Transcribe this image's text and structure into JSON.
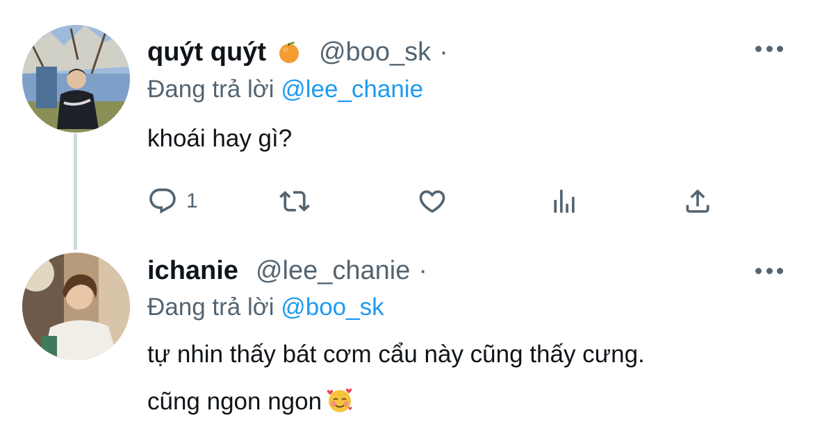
{
  "tweets": [
    {
      "display_name": "quýt quýt",
      "name_emoji": "orange-emoji",
      "handle": "@boo_sk",
      "separator": "·",
      "reply_prefix": "Đang trả lời",
      "reply_to": "@lee_chanie",
      "text": "khoái hay gì?",
      "actions": {
        "reply_count": "1",
        "reply_icon": "comment-icon",
        "retweet_icon": "retweet-icon",
        "like_icon": "heart-icon",
        "views_icon": "analytics-icon",
        "share_icon": "share-icon"
      }
    },
    {
      "display_name": "ichanie",
      "handle": "@lee_chanie",
      "separator": "·",
      "reply_prefix": "Đang trả lời",
      "reply_to": "@boo_sk",
      "text_line_1": "tự nhin thấy bát cơm cẩu này cũng thấy cưng.",
      "text_line_2": "cũng ngon ngon",
      "text_emoji": "smiling-face-with-hearts-emoji"
    }
  ],
  "colors": {
    "text_primary": "#0f1419",
    "text_secondary": "#536471",
    "mention": "#1d9bf0",
    "thread_line": "#cfd9de"
  }
}
